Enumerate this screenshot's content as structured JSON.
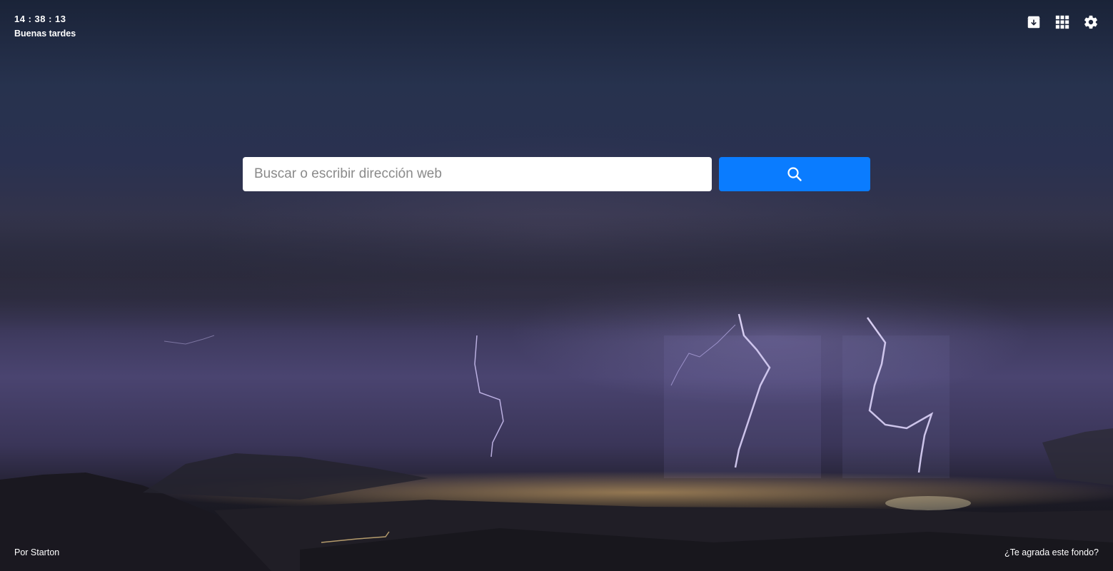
{
  "header": {
    "clock": "14 : 38 : 13",
    "greeting": "Buenas tardes"
  },
  "toolbar": {
    "icons": [
      "archive-download-icon",
      "apps-grid-icon",
      "gear-icon"
    ]
  },
  "search": {
    "placeholder": "Buscar o escribir dirección web",
    "value": "",
    "button_icon": "search-icon",
    "button_color": "#0a7cff"
  },
  "footer": {
    "credit": "Por Starton",
    "wallpaper_prompt": "¿Te agrada este fondo?"
  },
  "background": {
    "subject": "thunderstorm with lightning over city lights at night"
  }
}
